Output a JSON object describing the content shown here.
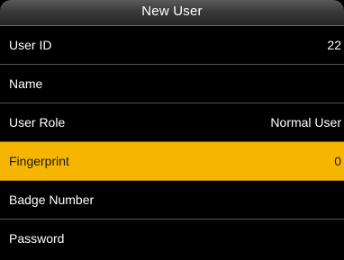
{
  "window": {
    "title": "New User"
  },
  "colors": {
    "background": "#000000",
    "selected_row": "#f6b500",
    "divider": "#555555",
    "text": "#ffffff"
  },
  "menu": {
    "selected_index": 3,
    "items": [
      {
        "label": "User ID",
        "value": "22"
      },
      {
        "label": "Name",
        "value": ""
      },
      {
        "label": "User Role",
        "value": "Normal User"
      },
      {
        "label": "Fingerprint",
        "value": "0"
      },
      {
        "label": "Badge Number",
        "value": ""
      },
      {
        "label": "Password",
        "value": ""
      }
    ]
  }
}
